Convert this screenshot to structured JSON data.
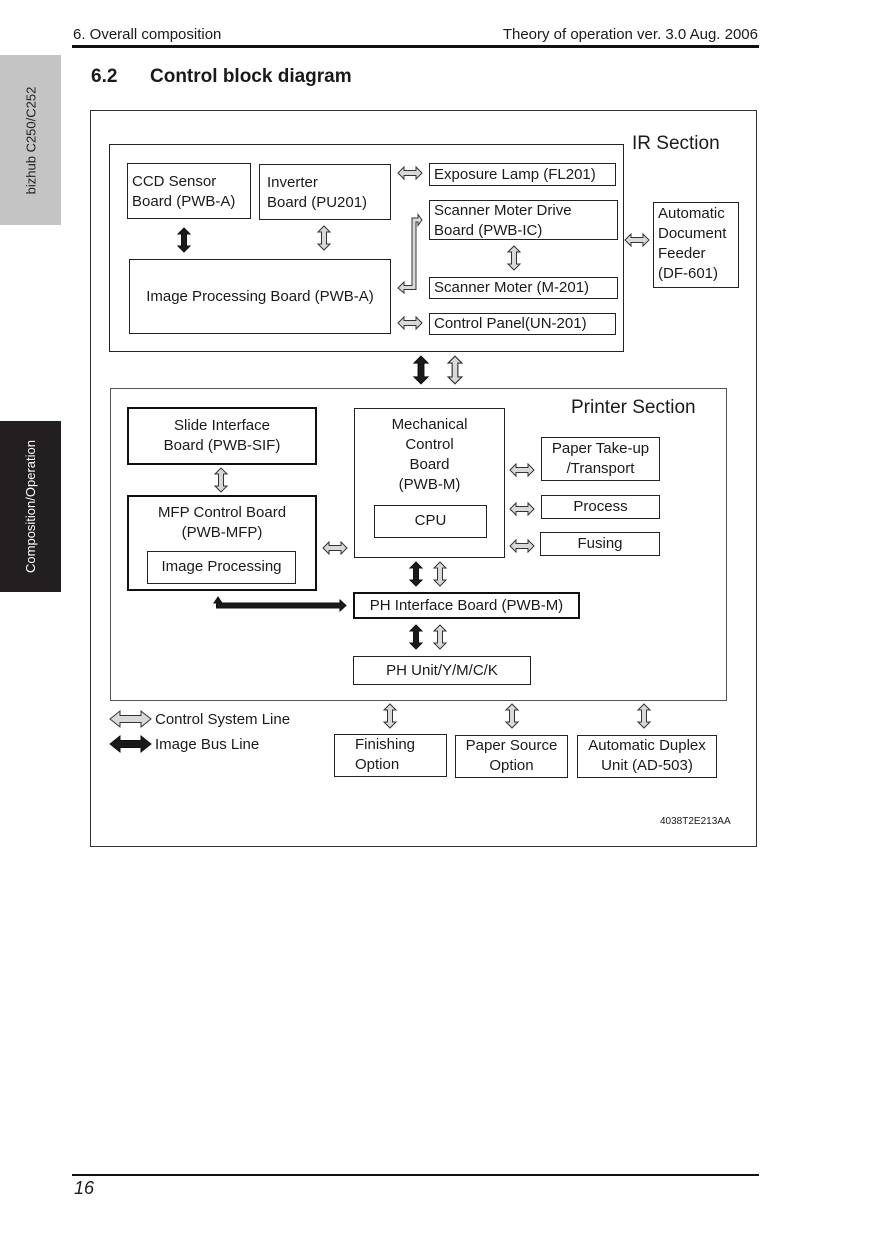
{
  "header": {
    "chapter": "6. Overall composition",
    "doc_title": "Theory of operation ver. 3.0 Aug. 2006"
  },
  "side_tabs": {
    "model": "bizhub C250/C252",
    "category": "Composition/Operation"
  },
  "section": {
    "number": "6.2",
    "title": "Control block diagram"
  },
  "diagram": {
    "ir_section": {
      "label": "IR  Section",
      "ccd_sensor": [
        "CCD Sensor",
        "Board (PWB-A)"
      ],
      "inverter": [
        "Inverter",
        "Board (PU201)"
      ],
      "image_processing": "Image Processing Board (PWB-A)",
      "exposure_lamp": "Exposure Lamp (FL201)",
      "scanner_drive": [
        "Scanner Moter Drive",
        "Board (PWB-IC)"
      ],
      "scanner_motor": "Scanner Moter (M-201)",
      "control_panel": "Control Panel(UN-201)"
    },
    "adf": [
      "Automatic",
      "Document",
      "Feeder",
      "(DF-601)"
    ],
    "printer_section": {
      "label": "Printer  Section",
      "slide_interface": [
        "Slide Interface",
        "Board (PWB-SIF)"
      ],
      "mfp_control": [
        "MFP Control Board",
        "(PWB-MFP)"
      ],
      "mfp_image_processing": "Image Processing",
      "mechanical_control": [
        "Mechanical",
        "Control",
        "Board",
        "(PWB-M)"
      ],
      "cpu": "CPU",
      "paper_takeup": [
        "Paper Take-up",
        "/Transport"
      ],
      "process": "Process",
      "fusing": "Fusing",
      "ph_interface": "PH Interface Board (PWB-M)",
      "ph_unit": "PH Unit/Y/M/C/K"
    },
    "options": {
      "finishing": [
        "Finishing",
        "Option"
      ],
      "paper_source": [
        "Paper Source",
        "Option"
      ],
      "duplex": [
        "Automatic Duplex",
        "Unit (AD-503)"
      ]
    },
    "legend": {
      "control_line": "Control System Line",
      "image_bus": "Image Bus Line"
    },
    "figure_code": "4038T2E213AA",
    "colors": {
      "control_arrow_fill": "#d9d9d9",
      "image_bus_fill": "#1a1a1a"
    }
  },
  "footer": {
    "page_number": "16"
  }
}
